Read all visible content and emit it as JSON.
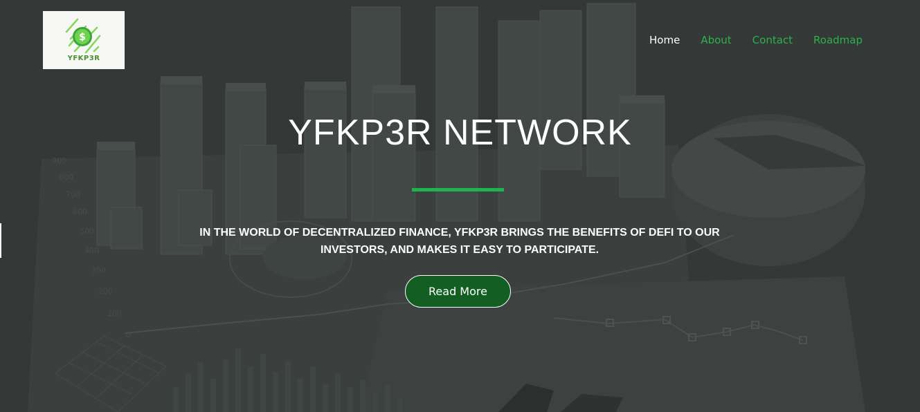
{
  "logo": {
    "text": "YFKP3R",
    "symbol": "$",
    "icon": "dollar-coin-icon"
  },
  "nav": {
    "items": [
      {
        "label": "Home",
        "active": true
      },
      {
        "label": "About",
        "active": false
      },
      {
        "label": "Contact",
        "active": false
      },
      {
        "label": "Roadmap",
        "active": false
      }
    ]
  },
  "hero": {
    "title": "YFKP3R NETWORK",
    "tagline": "IN THE WORLD OF DECENTRALIZED FINANCE, YFKP3R BRINGS THE BENEFITS OF DEFI TO OUR INVESTORS, AND MAKES IT EASY TO PARTICIPATE.",
    "cta_label": "Read More"
  },
  "colors": {
    "accent_green": "#2bb34a",
    "divider_green": "#1fb44f",
    "button_green": "#135e22",
    "logo_green": "#7ed957",
    "text_white": "#ffffff",
    "logo_text": "#4a8f2f"
  }
}
